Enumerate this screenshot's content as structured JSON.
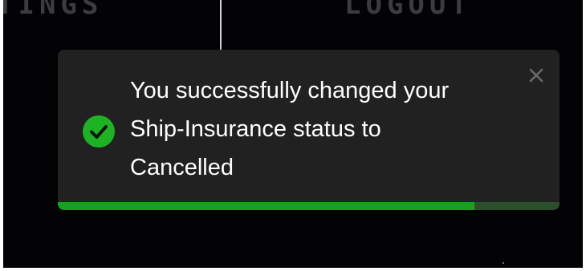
{
  "nav": {
    "settings_label": "TINGS",
    "logout_label": "LOGOUT"
  },
  "toast": {
    "icon": "check-circle-icon",
    "message_line1": "You successfully changed your",
    "message_line2": "Ship-Insurance status to",
    "message_line3": "Cancelled",
    "close_icon": "close-icon",
    "progress": 0.83
  },
  "colors": {
    "background": "#030305",
    "toast_background": "#212121",
    "success": "#1eb324",
    "progress_fill": "#12a41b",
    "progress_track": "#2b4f2a",
    "text": "#ffffff",
    "close_icon": "#6b6b6b"
  }
}
